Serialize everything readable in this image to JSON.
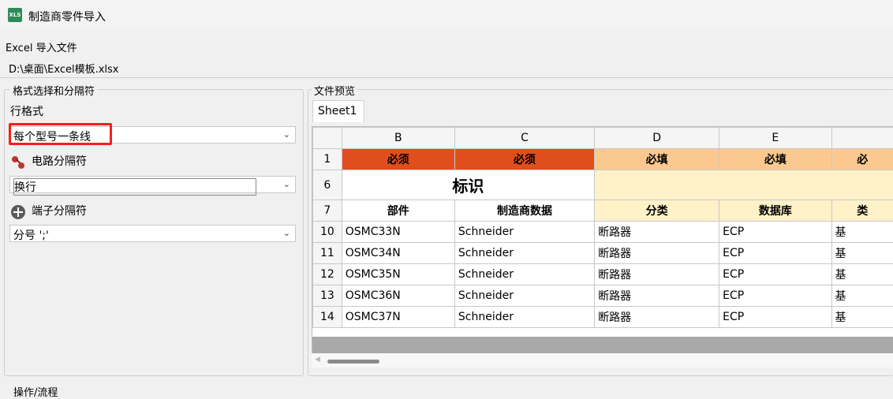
{
  "window": {
    "title": "制造商零件导入",
    "icon_text": "XLS"
  },
  "excel": {
    "label": "Excel 导入文件",
    "path": "D:\\桌面\\Excel模板.xlsx"
  },
  "format_group": {
    "title": "格式选择和分隔符",
    "row_format": {
      "label": "行格式",
      "value": "每个型号一条线"
    },
    "circuit_sep": {
      "label": "电路分隔符",
      "value": "换行"
    },
    "terminal_sep": {
      "label": "端子分隔符",
      "value": "分号 ';'"
    }
  },
  "preview": {
    "title": "文件预览",
    "sheet_tab": "Sheet1",
    "columns": [
      "B",
      "C",
      "D",
      "E",
      ""
    ],
    "rows": [
      {
        "num": "1",
        "cells": [
          "必须",
          "必须",
          "必填",
          "必填",
          "必"
        ]
      },
      {
        "num": "6",
        "label": "标识"
      },
      {
        "num": "7",
        "cells": [
          "部件",
          "制造商数据",
          "分类",
          "数据库",
          "类"
        ]
      },
      {
        "num": "10",
        "cells": [
          "OSMC33N",
          "Schneider",
          "断路器",
          "ECP",
          "基"
        ]
      },
      {
        "num": "11",
        "cells": [
          "OSMC34N",
          "Schneider",
          "断路器",
          "ECP",
          "基"
        ]
      },
      {
        "num": "12",
        "cells": [
          "OSMC35N",
          "Schneider",
          "断路器",
          "ECP",
          "基"
        ]
      },
      {
        "num": "13",
        "cells": [
          "OSMC36N",
          "Schneider",
          "断路器",
          "ECP",
          "基"
        ]
      },
      {
        "num": "14",
        "cells": [
          "OSMC37N",
          "Schneider",
          "断路器",
          "ECP",
          "基"
        ]
      }
    ]
  },
  "bottom": {
    "title": "操作/流程"
  },
  "colors": {
    "required_dark": "#e04e1e",
    "required_light": "#fbc98f",
    "header_cream": "#fff1c8",
    "highlight_red": "#ff1a1a"
  }
}
